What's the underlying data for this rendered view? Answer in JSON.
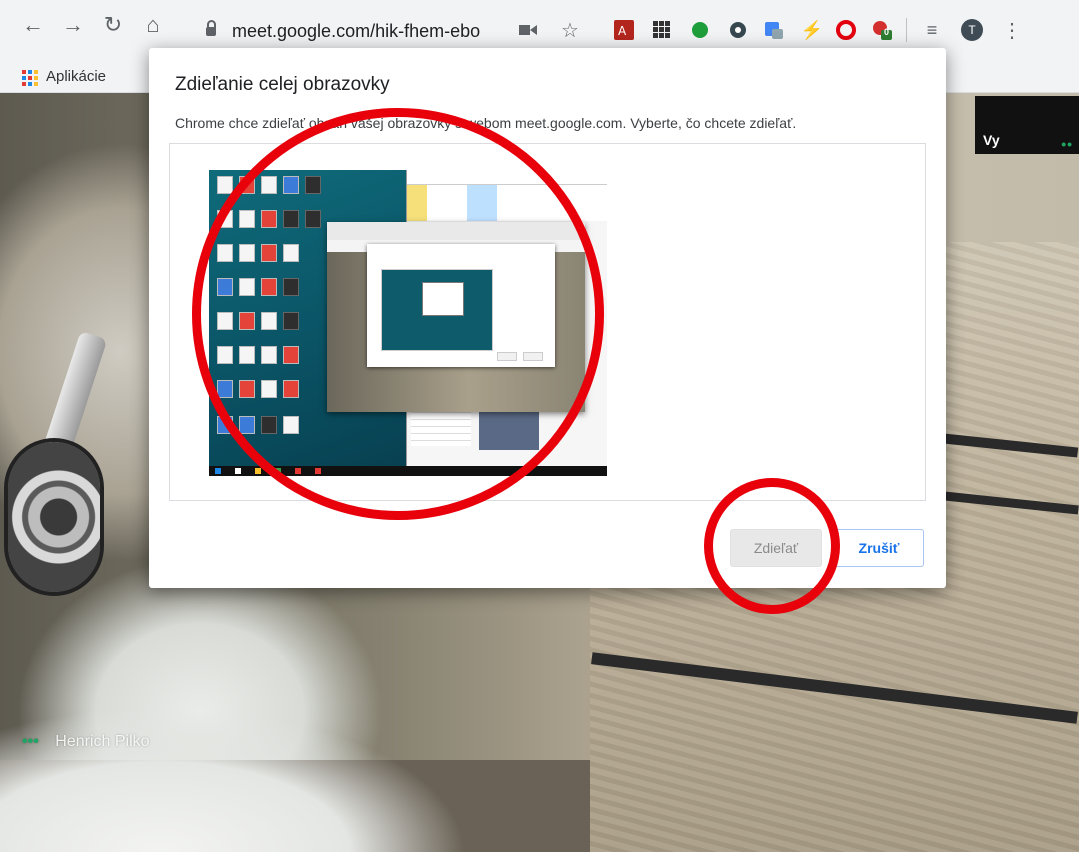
{
  "browser": {
    "url": "meet.google.com/hik-fhem-ebo",
    "profile_initial": "T",
    "badge_count": "0"
  },
  "bookmarks": {
    "apps_label": "Aplikácie"
  },
  "dialog": {
    "title": "Zdieľanie celej obrazovky",
    "description": "Chrome chce zdieľať obsah vašej obrazovky s webom meet.google.com. Vyberte, čo chcete zdieľať.",
    "share_label": "Zdieľať",
    "cancel_label": "Zrušiť"
  },
  "meeting": {
    "self_label": "Vy",
    "self_dots": "••",
    "participant_name": "Henrich Pilko",
    "participant_dots": "•••"
  },
  "colors": {
    "annotation": "#e8000b",
    "link_blue": "#1a73e8",
    "meet_green": "#1fa463"
  }
}
